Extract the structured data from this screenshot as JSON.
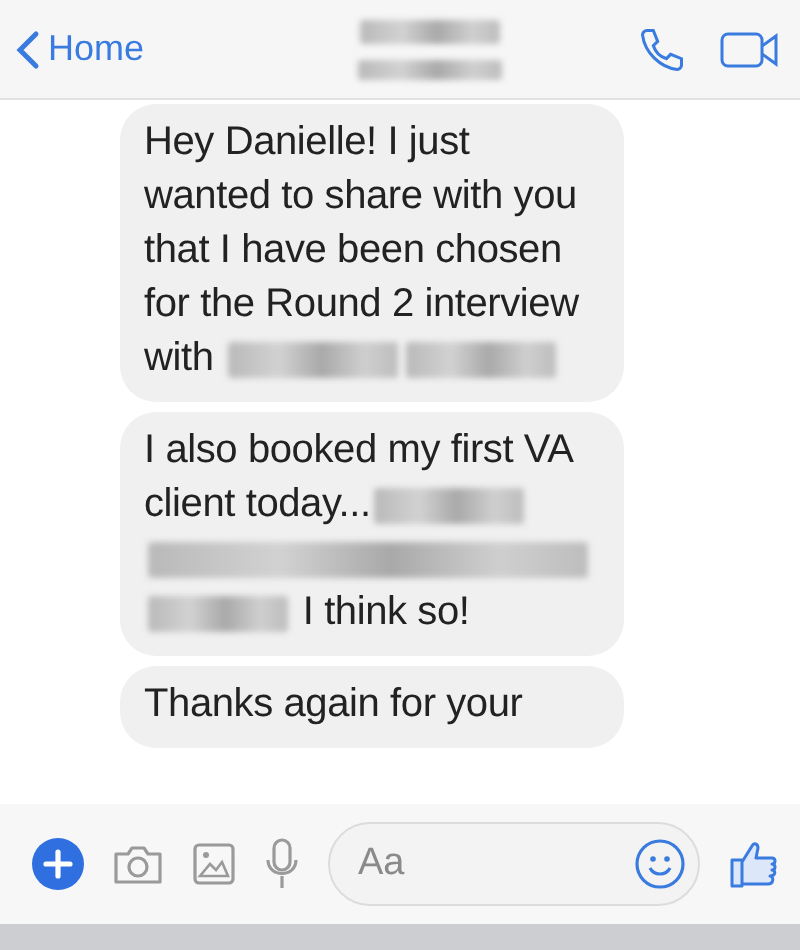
{
  "header": {
    "back_label": "Home",
    "title": {
      "kind": "redacted"
    }
  },
  "messages": [
    {
      "parts": [
        {
          "kind": "text",
          "text": "Hey Danielle! I just wanted to share with you that I have been chosen for the Round 2 interview with "
        },
        {
          "kind": "redacted"
        },
        {
          "kind": "redacted"
        }
      ]
    },
    {
      "parts": [
        {
          "kind": "text",
          "text": "I also booked my first VA client today..."
        },
        {
          "kind": "redacted"
        },
        {
          "kind": "redacted"
        },
        {
          "kind": "redacted"
        },
        {
          "kind": "text",
          "text": " I think so!"
        }
      ]
    },
    {
      "parts": [
        {
          "kind": "text",
          "text": "Thanks again for your"
        }
      ]
    }
  ],
  "composer": {
    "placeholder": "Aa"
  }
}
